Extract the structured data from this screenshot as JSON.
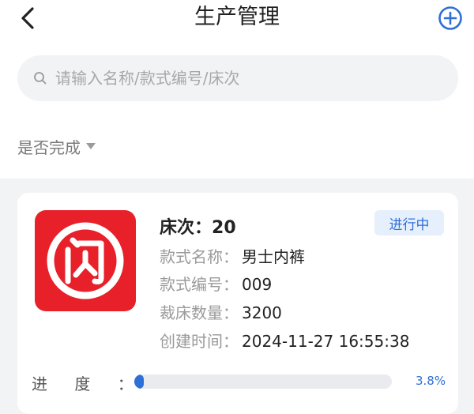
{
  "header": {
    "title": "生产管理",
    "back_icon": "chevron-left-icon",
    "add_icon": "plus-circle-icon",
    "accent_color": "#2f6fd8"
  },
  "search": {
    "placeholder": "请输入名称/款式编号/床次",
    "value": "",
    "icon": "search-icon"
  },
  "filter": {
    "label": "是否完成",
    "icon": "caret-down-icon"
  },
  "card": {
    "logo_icon": "shan-logo-icon",
    "logo_color": "#e8202a",
    "bed_label": "床次：",
    "bed_value": "20",
    "status": "进行中",
    "fields": [
      {
        "label": "款式名称：",
        "value": "男士内裤"
      },
      {
        "label": "款式编号：",
        "value": "009"
      },
      {
        "label": "裁床数量：",
        "value": "3200"
      },
      {
        "label": "创建时间：",
        "value": "2024-11-27 16:55:38"
      }
    ],
    "progress_label": "进 度 ：",
    "progress_value": 3.8,
    "progress_text": "3.8%"
  }
}
